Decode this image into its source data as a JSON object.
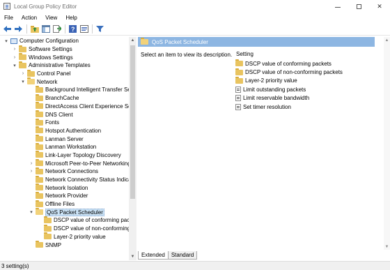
{
  "window": {
    "title": "Local Group Policy Editor",
    "minimize": "—",
    "maximize": "",
    "close": "✕"
  },
  "menu": [
    "File",
    "Action",
    "View",
    "Help"
  ],
  "toolbar": {
    "buttons": [
      "back-arrow-icon",
      "forward-arrow-icon",
      "up-folder-icon",
      "show-hide-tree-icon",
      "export-list-icon",
      "help-icon",
      "properties-icon",
      "filter-icon"
    ]
  },
  "tree": {
    "items": [
      {
        "label": "Computer Configuration",
        "depth": 0,
        "expander": "▾",
        "icon": "computer"
      },
      {
        "label": "Software Settings",
        "depth": 1,
        "expander": "›",
        "icon": "folder"
      },
      {
        "label": "Windows Settings",
        "depth": 1,
        "expander": "›",
        "icon": "folder"
      },
      {
        "label": "Administrative Templates",
        "depth": 1,
        "expander": "▾",
        "icon": "folder"
      },
      {
        "label": "Control Panel",
        "depth": 2,
        "expander": "›",
        "icon": "folder"
      },
      {
        "label": "Network",
        "depth": 2,
        "expander": "▾",
        "icon": "folder-open"
      },
      {
        "label": "Background Intelligent Transfer Ser",
        "depth": 3,
        "expander": "",
        "icon": "folder"
      },
      {
        "label": "BranchCache",
        "depth": 3,
        "expander": "",
        "icon": "folder"
      },
      {
        "label": "DirectAccess Client Experience Sett",
        "depth": 3,
        "expander": "",
        "icon": "folder"
      },
      {
        "label": "DNS Client",
        "depth": 3,
        "expander": "",
        "icon": "folder"
      },
      {
        "label": "Fonts",
        "depth": 3,
        "expander": "",
        "icon": "folder"
      },
      {
        "label": "Hotspot Authentication",
        "depth": 3,
        "expander": "",
        "icon": "folder"
      },
      {
        "label": "Lanman Server",
        "depth": 3,
        "expander": "",
        "icon": "folder"
      },
      {
        "label": "Lanman Workstation",
        "depth": 3,
        "expander": "",
        "icon": "folder"
      },
      {
        "label": "Link-Layer Topology Discovery",
        "depth": 3,
        "expander": "",
        "icon": "folder"
      },
      {
        "label": "Microsoft Peer-to-Peer Networking",
        "depth": 3,
        "expander": "›",
        "icon": "folder"
      },
      {
        "label": "Network Connections",
        "depth": 3,
        "expander": "›",
        "icon": "folder"
      },
      {
        "label": "Network Connectivity Status Indica",
        "depth": 3,
        "expander": "",
        "icon": "folder"
      },
      {
        "label": "Network Isolation",
        "depth": 3,
        "expander": "",
        "icon": "folder"
      },
      {
        "label": "Network Provider",
        "depth": 3,
        "expander": "",
        "icon": "folder"
      },
      {
        "label": "Offline Files",
        "depth": 3,
        "expander": "",
        "icon": "folder"
      },
      {
        "label": "QoS Packet Scheduler",
        "depth": 3,
        "expander": "▾",
        "icon": "folder-open",
        "selected": true
      },
      {
        "label": "DSCP value of conforming pac",
        "depth": 4,
        "expander": "",
        "icon": "folder"
      },
      {
        "label": "DSCP value of non-conforming",
        "depth": 4,
        "expander": "",
        "icon": "folder"
      },
      {
        "label": "Layer-2 priority value",
        "depth": 4,
        "expander": "",
        "icon": "folder"
      },
      {
        "label": "SNMP",
        "depth": 3,
        "expander": "",
        "icon": "folder"
      }
    ]
  },
  "right_pane": {
    "header": "QoS Packet Scheduler",
    "description": "Select an item to view its description.",
    "column_header": "Setting",
    "items": [
      {
        "label": "DSCP value of conforming packets",
        "icon": "folder"
      },
      {
        "label": "DSCP value of non-conforming packets",
        "icon": "folder"
      },
      {
        "label": "Layer-2 priority value",
        "icon": "folder"
      },
      {
        "label": "Limit outstanding packets",
        "icon": "setting"
      },
      {
        "label": "Limit reservable bandwidth",
        "icon": "setting"
      },
      {
        "label": "Set timer resolution",
        "icon": "setting"
      }
    ],
    "tabs": [
      "Extended",
      "Standard"
    ]
  },
  "status": "3 setting(s)"
}
